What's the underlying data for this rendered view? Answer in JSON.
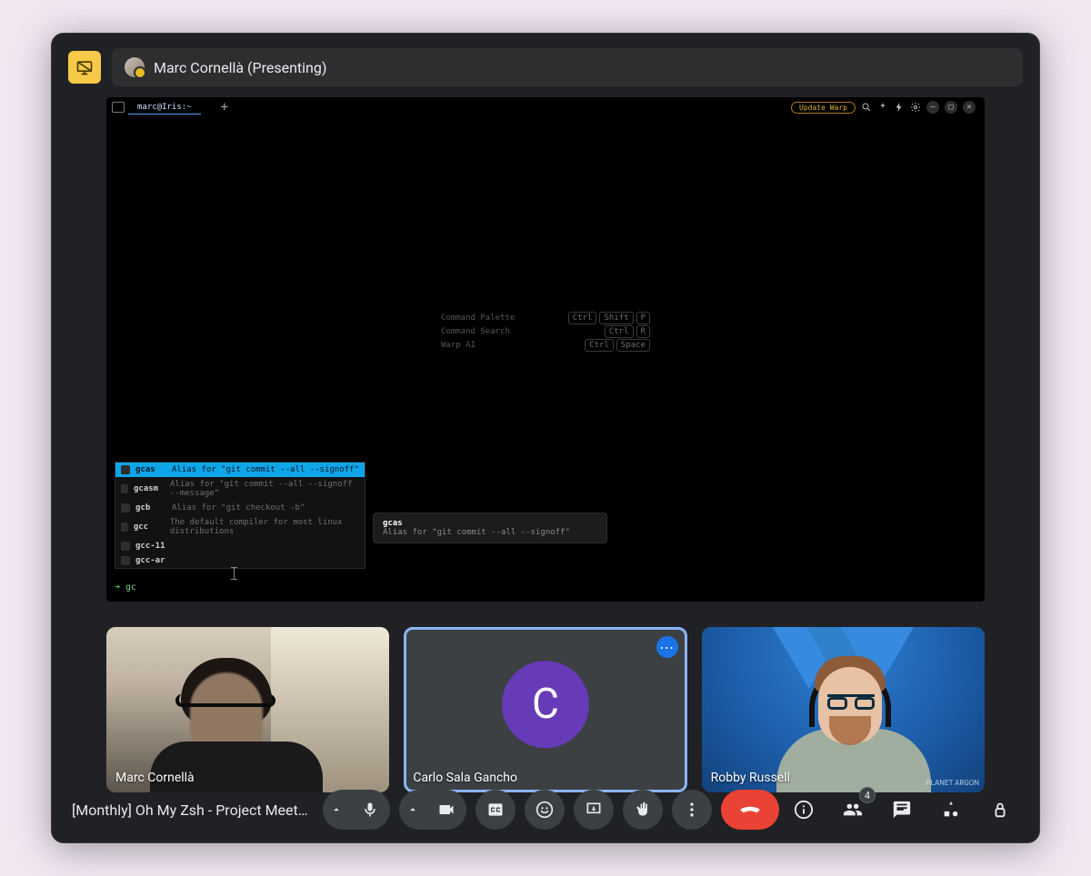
{
  "presenter": {
    "label": "Marc Cornellà (Presenting)"
  },
  "terminal": {
    "tab_title": "marc@Iris:~",
    "update_btn": "Update Warp",
    "hints": [
      {
        "label": "Command Palette",
        "keys": [
          "Ctrl",
          "Shift",
          "P"
        ]
      },
      {
        "label": "Command Search",
        "keys": [
          "Ctrl",
          "R"
        ]
      },
      {
        "label": "Warp AI",
        "keys": [
          "Ctrl",
          "Space"
        ]
      }
    ],
    "tooltip": {
      "title": "gcas",
      "desc": "Alias for \"git commit --all --signoff\""
    },
    "suggestions": [
      {
        "k": "gcas",
        "d": "Alias for \"git commit --all --signoff\"",
        "selected": true
      },
      {
        "k": "gcasm",
        "d": "Alias for \"git commit --all --signoff --message\""
      },
      {
        "k": "gcb",
        "d": "Alias for \"git checkout -b\""
      },
      {
        "k": "gcc",
        "d": "The default compiler for most linux distributions"
      },
      {
        "k": "gcc-11",
        "d": ""
      },
      {
        "k": "gcc-ar",
        "d": ""
      }
    ],
    "prompt": "gc"
  },
  "participants": [
    {
      "name": "Marc Cornellà"
    },
    {
      "name": "Carlo Sala Gancho",
      "initial": "C",
      "active": true
    },
    {
      "name": "Robby Russell",
      "corp": "PLANET\nARGON"
    }
  ],
  "meeting": {
    "title": "[Monthly] Oh My Zsh - Project Meet…",
    "participant_count": "4"
  }
}
